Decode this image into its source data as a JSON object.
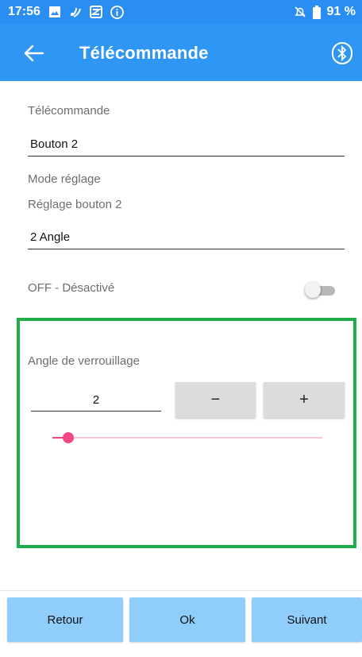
{
  "status_bar": {
    "time": "17:56",
    "battery": "91 %",
    "icons": [
      "image-icon",
      "nfc-icon",
      "vpn-icon",
      "info-icon",
      "alarm-off-icon",
      "battery-icon"
    ]
  },
  "app_bar": {
    "title": "Télécommande",
    "color": "#2f96f3",
    "left_icon": "back-arrow-icon",
    "right_icon": "bluetooth-icon"
  },
  "form": {
    "remote_label": "Télécommande",
    "remote_value": "Bouton 2",
    "mode_label": "Mode réglage",
    "setting_label": "Réglage bouton 2",
    "setting_value": "2 Angle",
    "toggle_label": "OFF - Désactivé",
    "toggle_on": false
  },
  "lock_panel": {
    "border_color": "#1fae4b",
    "title": "Angle de verrouillage",
    "value": "2",
    "minus_label": "−",
    "plus_label": "+",
    "slider_fraction": 0.03,
    "slider_color": "#f24785"
  },
  "footer": {
    "back_label": "Retour",
    "ok_label": "Ok",
    "next_label": "Suivant",
    "button_color": "#8fcdfa"
  }
}
